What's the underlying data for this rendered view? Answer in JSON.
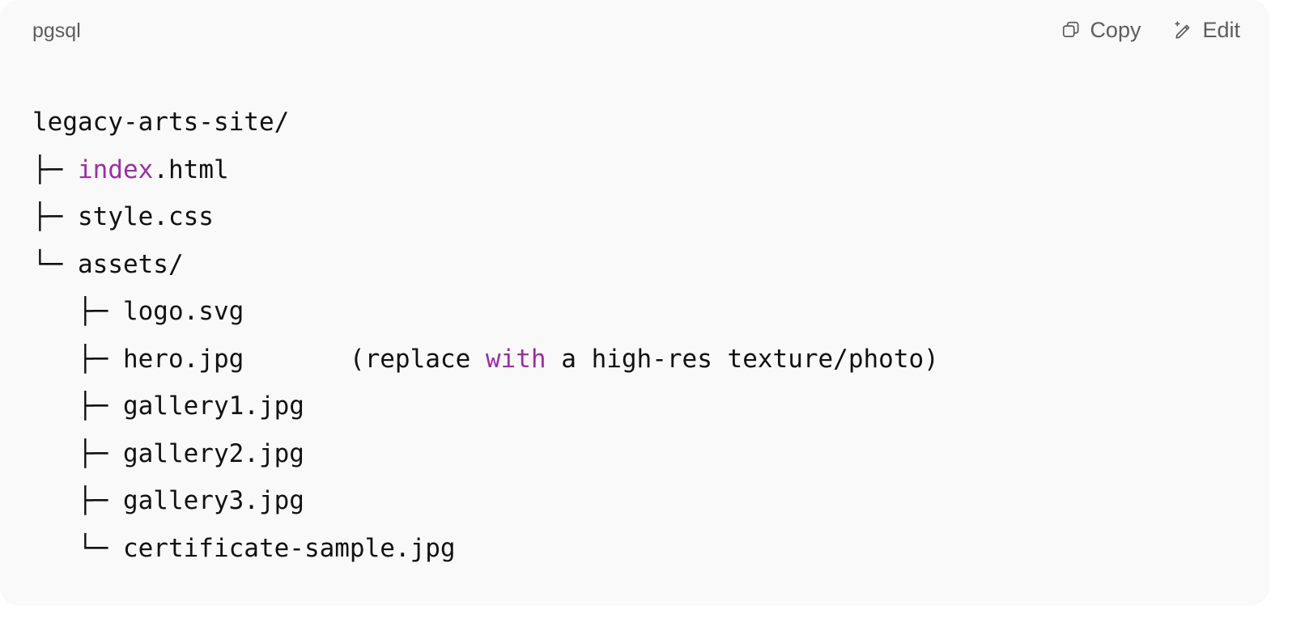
{
  "header": {
    "language": "pgsql",
    "copy_label": "Copy",
    "edit_label": "Edit"
  },
  "colors": {
    "background": "#f9f9f9",
    "text": "#111111",
    "muted": "#5d5d5d",
    "keyword": "#9b2fa3"
  },
  "icons": {
    "copy": "copy-icon",
    "edit": "pencil-sparkle-icon"
  },
  "code": {
    "lines": [
      [
        {
          "text": "legacy-arts-site/"
        }
      ],
      [
        {
          "text": "├─ "
        },
        {
          "text": "index",
          "kw": true
        },
        {
          "text": ".html"
        }
      ],
      [
        {
          "text": "├─ style.css"
        }
      ],
      [
        {
          "text": "└─ assets/"
        }
      ],
      [
        {
          "text": "   ├─ logo.svg"
        }
      ],
      [
        {
          "text": "   ├─ hero.jpg       (replace "
        },
        {
          "text": "with",
          "kw": true
        },
        {
          "text": " a high-res texture/photo)"
        }
      ],
      [
        {
          "text": "   ├─ gallery1.jpg"
        }
      ],
      [
        {
          "text": "   ├─ gallery2.jpg"
        }
      ],
      [
        {
          "text": "   ├─ gallery3.jpg"
        }
      ],
      [
        {
          "text": "   └─ certificate-sample.jpg"
        }
      ]
    ]
  }
}
